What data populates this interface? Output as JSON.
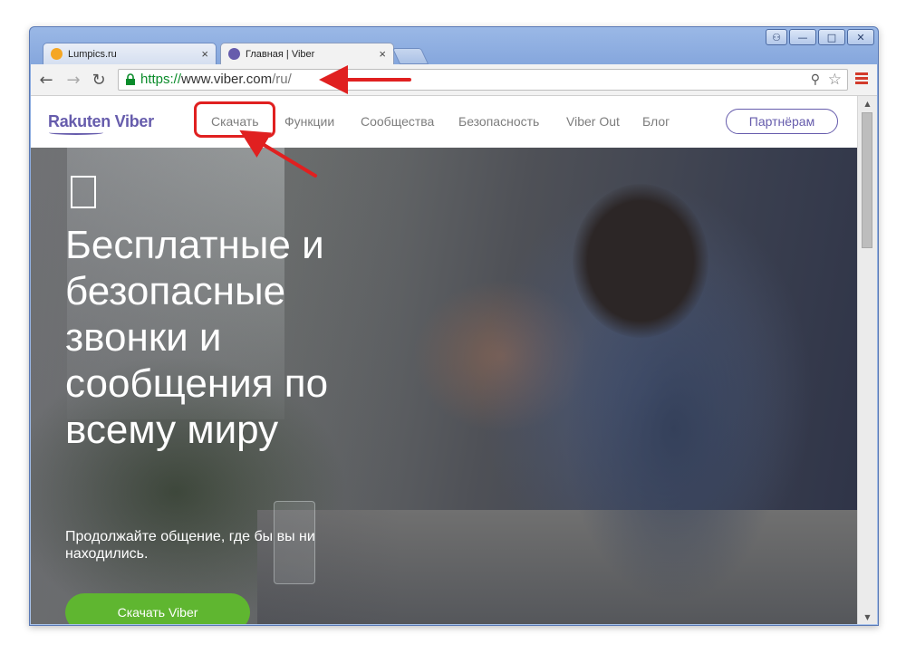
{
  "browser": {
    "tabs": [
      {
        "title": "Lumpics.ru",
        "close": "×",
        "favicon_color": "#f5a623"
      },
      {
        "title": "Главная | Viber",
        "close": "×",
        "favicon_color": "#665cac"
      }
    ],
    "url": {
      "scheme": "https://",
      "host": "www.viber.com",
      "path": "/ru/"
    },
    "window_controls": {
      "minimize": "—",
      "maximize": "□",
      "close": "✕",
      "profile": "⚇"
    }
  },
  "site": {
    "logo": "Rakuten Viber",
    "nav": [
      {
        "label": "Скачать"
      },
      {
        "label": "Функции"
      },
      {
        "label": "Сообщества"
      },
      {
        "label": "Безопасность"
      },
      {
        "label": "Viber Out"
      },
      {
        "label": "Блог"
      }
    ],
    "partner_button": "Партнёрам",
    "hero": {
      "title_lines": [
        "Бесплатные и",
        "безопасные",
        "звонки и",
        "сообщения по",
        "всему миру"
      ],
      "subtitle_lines": [
        "Продолжайте общение, где бы вы ни",
        "находились."
      ],
      "cta": "Скачать Viber"
    }
  },
  "colors": {
    "brand": "#665cac",
    "cta": "#5fb630",
    "annotation": "#e02020"
  }
}
